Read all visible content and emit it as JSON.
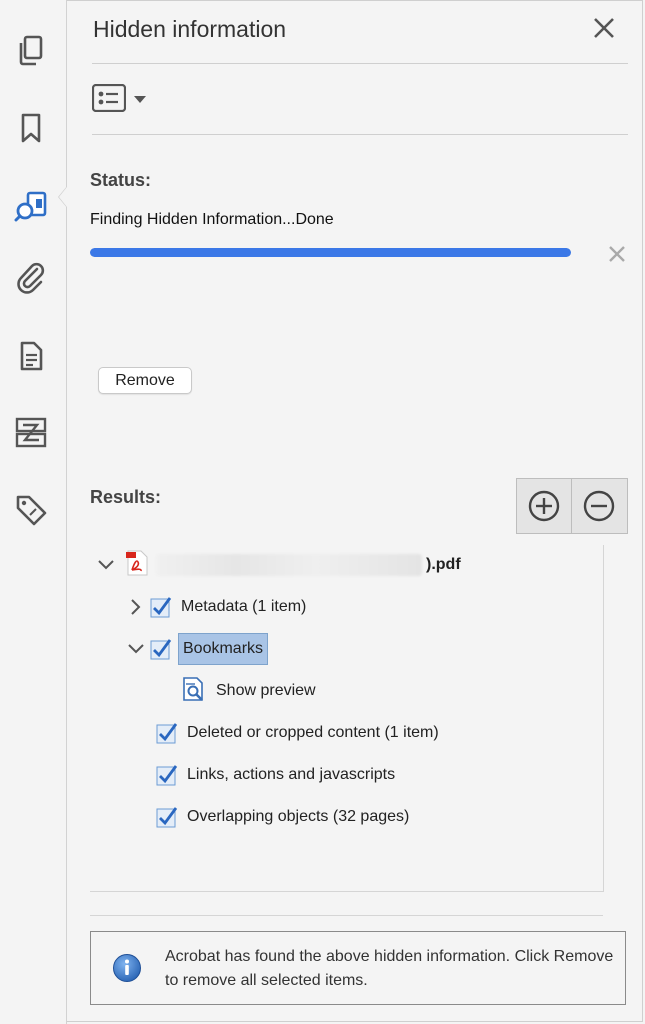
{
  "panel": {
    "title": "Hidden information",
    "status_label": "Status:",
    "status_text": "Finding Hidden Information...Done",
    "progress_fraction": 1.0,
    "remove_label": "Remove",
    "results_label": "Results:",
    "accent_color": "#3b78e7"
  },
  "rail": {
    "icons": [
      "pages-icon",
      "bookmark-icon",
      "hidden-info-icon",
      "attachment-icon",
      "document-icon",
      "compare-icon",
      "tag-icon"
    ],
    "active": "hidden-info-icon"
  },
  "results": {
    "file_suffix": ").pdf",
    "items": [
      {
        "label": "Metadata (1 item)",
        "expanded": false,
        "checked": true
      },
      {
        "label": "Bookmarks",
        "expanded": true,
        "checked": true,
        "selected": true
      },
      {
        "label": "Show preview"
      },
      {
        "label": "Deleted or cropped content (1 item)",
        "checked": true
      },
      {
        "label": "Links, actions and javascripts",
        "checked": true
      },
      {
        "label": "Overlapping objects (32 pages)",
        "checked": true
      }
    ]
  },
  "info": {
    "message": "Acrobat has found the above hidden information. Click Remove to remove all selected items."
  }
}
